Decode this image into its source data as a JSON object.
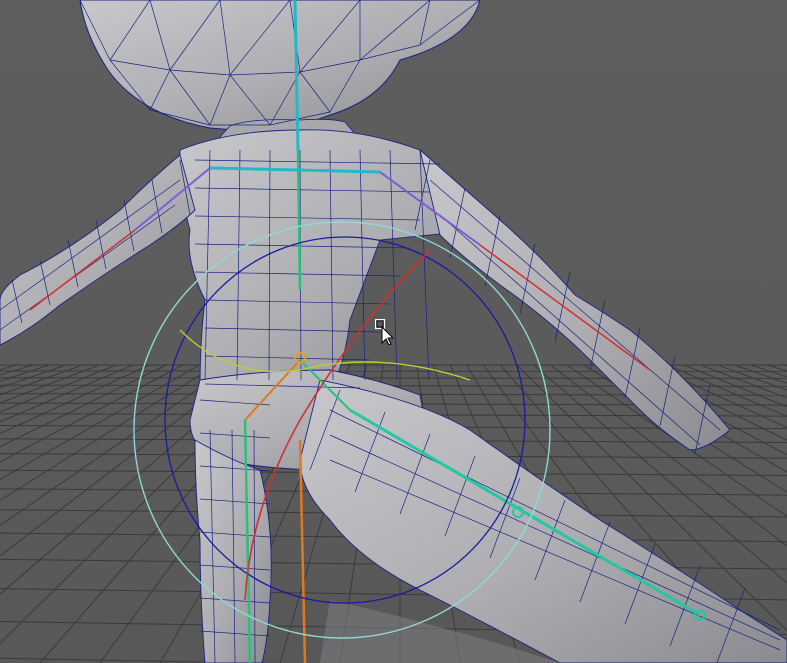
{
  "viewport": {
    "background_color": "#5c5c5c",
    "grid_color": "#3a3a3a",
    "mesh_fill_color": "#b4b4b8",
    "wire_color": "#1a237e"
  },
  "rig": {
    "spine_color": "#22b8c8",
    "joint_color": "#28c07a",
    "ik_control_colors": [
      "#8fd9d0",
      "#1a1aa0",
      "#d03030",
      "#e07820"
    ]
  },
  "cursor": {
    "icon": "select-move-cursor"
  }
}
